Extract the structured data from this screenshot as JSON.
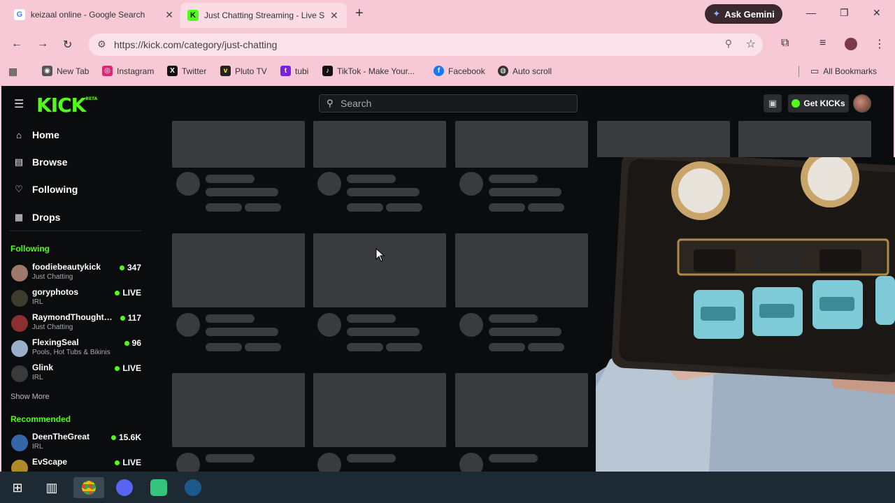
{
  "browser": {
    "tabs": [
      {
        "title": "keizaal online - Google Search",
        "icon": "google-icon"
      },
      {
        "title": "Just Chatting Streaming - Live S",
        "icon": "kick-icon"
      }
    ],
    "ask_gemini": "Ask Gemini",
    "url": "https://kick.com/category/just-chatting",
    "bookmarks": [
      {
        "label": "New Tab",
        "color": "#555555"
      },
      {
        "label": "Instagram",
        "color": "#d62976"
      },
      {
        "label": "Twitter",
        "color": "#111111"
      },
      {
        "label": "Pluto TV",
        "color": "#222222"
      },
      {
        "label": "tubi",
        "color": "#7b1fd8"
      },
      {
        "label": "TikTok - Make Your...",
        "color": "#111111"
      },
      {
        "label": "Facebook",
        "color": "#1877f2"
      },
      {
        "label": "Auto scroll",
        "color": "#333333"
      }
    ],
    "all_bookmarks": "All Bookmarks"
  },
  "kick": {
    "logo": "KICK",
    "logo_badge": "BETA",
    "search_placeholder": "Search",
    "get_kicks": "Get KICKs",
    "nav": [
      {
        "label": "Home",
        "icon": "home-icon"
      },
      {
        "label": "Browse",
        "icon": "browse-icon"
      },
      {
        "label": "Following",
        "icon": "heart-icon"
      },
      {
        "label": "Drops",
        "icon": "drops-icon"
      }
    ],
    "following_title": "Following",
    "following": [
      {
        "name": "foodiebeautykick",
        "category": "Just Chatting",
        "status": "347",
        "avatar": "#a0786a"
      },
      {
        "name": "goryphotos",
        "category": "IRL",
        "status": "LIVE",
        "avatar": "#3b3b2e"
      },
      {
        "name": "RaymondThoughts...",
        "category": "Just Chatting",
        "status": "117",
        "avatar": "#8a3030"
      },
      {
        "name": "FlexingSeal",
        "category": "Pools, Hot Tubs & Bikinis",
        "status": "96",
        "avatar": "#9ab0c8"
      },
      {
        "name": "Glink",
        "category": "IRL",
        "status": "LIVE",
        "avatar": "#3a3a3a"
      }
    ],
    "show_more": "Show More",
    "recommended_title": "Recommended",
    "recommended": [
      {
        "name": "DeenTheGreat",
        "category": "IRL",
        "status": "15.6K",
        "avatar": "#3567a8"
      },
      {
        "name": "EvScape",
        "category": "",
        "status": "LIVE",
        "avatar": "#b08a2a"
      }
    ],
    "accent": "#53fc18"
  }
}
